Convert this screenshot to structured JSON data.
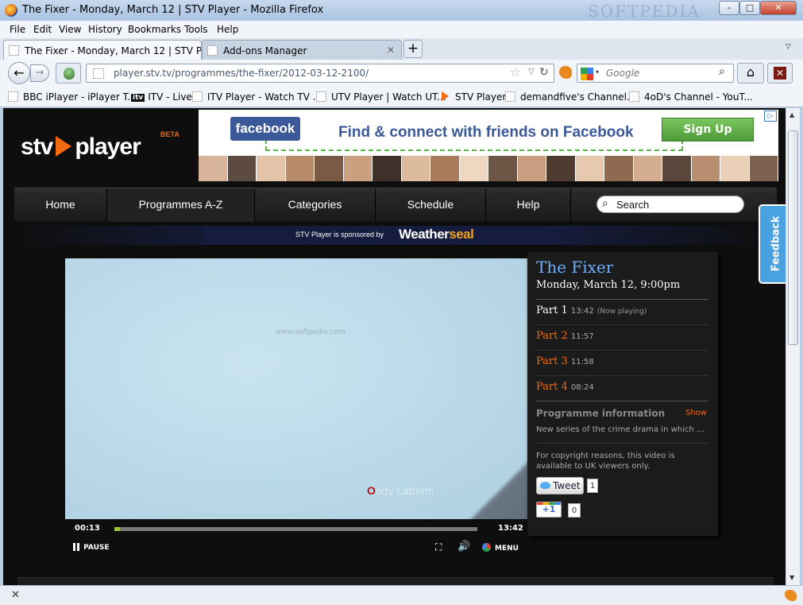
{
  "window": {
    "title": "The Fixer - Monday, March 12 | STV Player - Mozilla Firefox",
    "watermark": "SOFTPEDIA",
    "min": "–",
    "max": "□",
    "close": "✕"
  },
  "menu": [
    "File",
    "Edit",
    "View",
    "History",
    "Bookmarks",
    "Tools",
    "Help"
  ],
  "tabs": [
    {
      "label": "The Fixer - Monday, March 12 | STV P...",
      "active": true
    },
    {
      "label": "Add-ons Manager",
      "active": false
    }
  ],
  "tab_close": "✕",
  "new_tab": "+",
  "tab_list": "▽",
  "nav": {
    "url": "player.stv.tv/programmes/the-fixer/2012-03-12-2100/",
    "search_placeholder": "Google",
    "back": "←",
    "forward": "→",
    "star": "☆",
    "dropdown": "▽",
    "reload": "↻",
    "home": "⌂",
    "magnifier": "⌕",
    "engine_dd": "▾",
    "addon": "✕"
  },
  "bookmarks": [
    "BBC iPlayer - iPlayer T...",
    "ITV - Live",
    "ITV Player - Watch TV ...",
    "UTV Player | Watch UT...",
    "STV Player",
    "demandfive's Channel...",
    "4oD's Channel - YouT..."
  ],
  "itv_badge": "itv",
  "site": {
    "logo_left": "stv",
    "logo_right": "player",
    "beta": "BETA",
    "ad": {
      "facebook": "facebook",
      "message": "Find & connect with friends on Facebook",
      "signup": "Sign Up",
      "adchoice": "▷"
    },
    "nav_items": [
      "Home",
      "Programmes A-Z",
      "Categories",
      "Schedule",
      "Help"
    ],
    "search": "Search",
    "sponsor_text": "STV Player is sponsored by",
    "sponsor_brand_a": "Weather",
    "sponsor_brand_b": "seal",
    "video_caption_a": "O",
    "video_caption_b": "ody Latham",
    "video_watermark": "www.softpedia.com",
    "player": {
      "elapsed": "00:13",
      "duration": "13:42",
      "progress": 0.016,
      "pause": "PAUSE",
      "menu": "MENU",
      "fullscreen": "⛶",
      "volume": "🔊"
    },
    "programme": {
      "title": "The Fixer",
      "date": "Monday, March 12, 9:00pm",
      "parts": [
        {
          "name": "Part 1",
          "duration": "13:42",
          "note": "(Now playing)"
        },
        {
          "name": "Part 2",
          "duration": "11:57",
          "note": ""
        },
        {
          "name": "Part 3",
          "duration": "11:58",
          "note": ""
        },
        {
          "name": "Part 4",
          "duration": "08:24",
          "note": ""
        }
      ],
      "info_heading": "Programme information",
      "info_show": "Show",
      "description": "New series of the crime drama in which st...",
      "copyright": "For copyright reasons, this video is available to UK viewers only.",
      "tweet": "Tweet",
      "tweet_count": "1",
      "plusone": "+1",
      "plusone_count": "0"
    },
    "feedback": "Feedback"
  },
  "status": {
    "close": "✕"
  },
  "colors": {
    "accent": "#f26b10",
    "link": "#6cb0ff",
    "facebook": "#3b5998"
  }
}
